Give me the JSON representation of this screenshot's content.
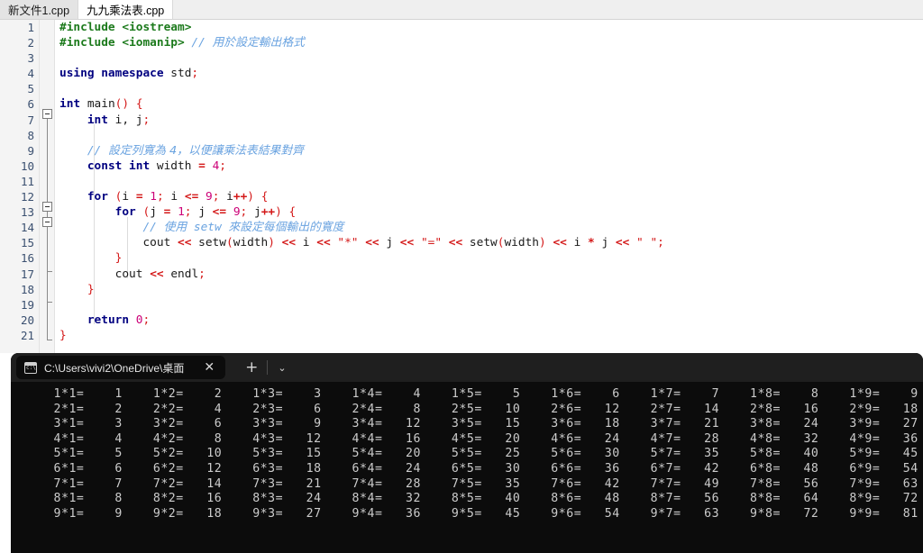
{
  "editor": {
    "tabs": [
      {
        "label": "新文件1.cpp",
        "active": false
      },
      {
        "label": "九九乘法表.cpp",
        "active": true
      }
    ],
    "lines": [
      {
        "n": "1",
        "text": "#include <iostream>"
      },
      {
        "n": "2",
        "text": "#include <iomanip> // 用於設定輸出格式"
      },
      {
        "n": "3",
        "text": ""
      },
      {
        "n": "4",
        "text": "using namespace std;"
      },
      {
        "n": "5",
        "text": ""
      },
      {
        "n": "6",
        "text": "int main() {"
      },
      {
        "n": "7",
        "text": "    int i, j;"
      },
      {
        "n": "8",
        "text": ""
      },
      {
        "n": "9",
        "text": "    // 設定列寬為 4，以便讓乘法表結果對齊"
      },
      {
        "n": "10",
        "text": "    const int width = 4;"
      },
      {
        "n": "11",
        "text": ""
      },
      {
        "n": "12",
        "text": "    for (i = 1; i <= 9; i++) {"
      },
      {
        "n": "13",
        "text": "        for (j = 1; j <= 9; j++) {"
      },
      {
        "n": "14",
        "text": "            // 使用 setw 來設定每個輸出的寬度"
      },
      {
        "n": "15",
        "text": "            cout << setw(width) << i << \"*\" << j << \"=\" << setw(width) << i * j << \" \";"
      },
      {
        "n": "16",
        "text": "        }"
      },
      {
        "n": "17",
        "text": "        cout << endl;"
      },
      {
        "n": "18",
        "text": "    }"
      },
      {
        "n": "19",
        "text": ""
      },
      {
        "n": "20",
        "text": "    return 0;"
      },
      {
        "n": "21",
        "text": "}"
      }
    ]
  },
  "terminal": {
    "tab": {
      "title": "C:\\Users\\vivi2\\OneDrive\\桌面",
      "icon": "cmd-icon",
      "close_label": "✕"
    },
    "new_tab_label": "+",
    "dropdown_label": "⌄",
    "output_lines": [
      "   1*1=    1    1*2=    2    1*3=    3    1*4=    4    1*5=    5    1*6=    6    1*7=    7    1*8=    8    1*9=    9 ",
      "   2*1=    2    2*2=    4    2*3=    6    2*4=    8    2*5=   10    2*6=   12    2*7=   14    2*8=   16    2*9=   18 ",
      "   3*1=    3    3*2=    6    3*3=    9    3*4=   12    3*5=   15    3*6=   18    3*7=   21    3*8=   24    3*9=   27 ",
      "   4*1=    4    4*2=    8    4*3=   12    4*4=   16    4*5=   20    4*6=   24    4*7=   28    4*8=   32    4*9=   36 ",
      "   5*1=    5    5*2=   10    5*3=   15    5*4=   20    5*5=   25    5*6=   30    5*7=   35    5*8=   40    5*9=   45 ",
      "   6*1=    6    6*2=   12    6*3=   18    6*4=   24    6*5=   30    6*6=   36    6*7=   42    6*8=   48    6*9=   54 ",
      "   7*1=    7    7*2=   14    7*3=   21    7*4=   28    7*5=   35    7*6=   42    7*7=   49    7*8=   56    7*9=   63 ",
      "   8*1=    8    8*2=   16    8*3=   24    8*4=   32    8*5=   40    8*6=   48    8*7=   56    8*8=   64    8*9=   72 ",
      "   9*1=    9    9*2=   18    9*3=   27    9*4=   36    9*5=   45    9*6=   54    9*7=   63    9*8=   72    9*9=   81 "
    ]
  },
  "colors": {
    "editor_bg": "#ffffff",
    "gutter_bg": "#f4f4f4",
    "terminal_bg": "#0c0c0c",
    "terminal_tabbar_bg": "#1f1f1f",
    "terminal_fg": "#cccccc",
    "keyword": "#000080",
    "preprocessor": "#1c7a1c",
    "string": "#d41919",
    "number": "#cc0077",
    "comment": "#6aa3e0",
    "linenumber": "#3b5070"
  }
}
